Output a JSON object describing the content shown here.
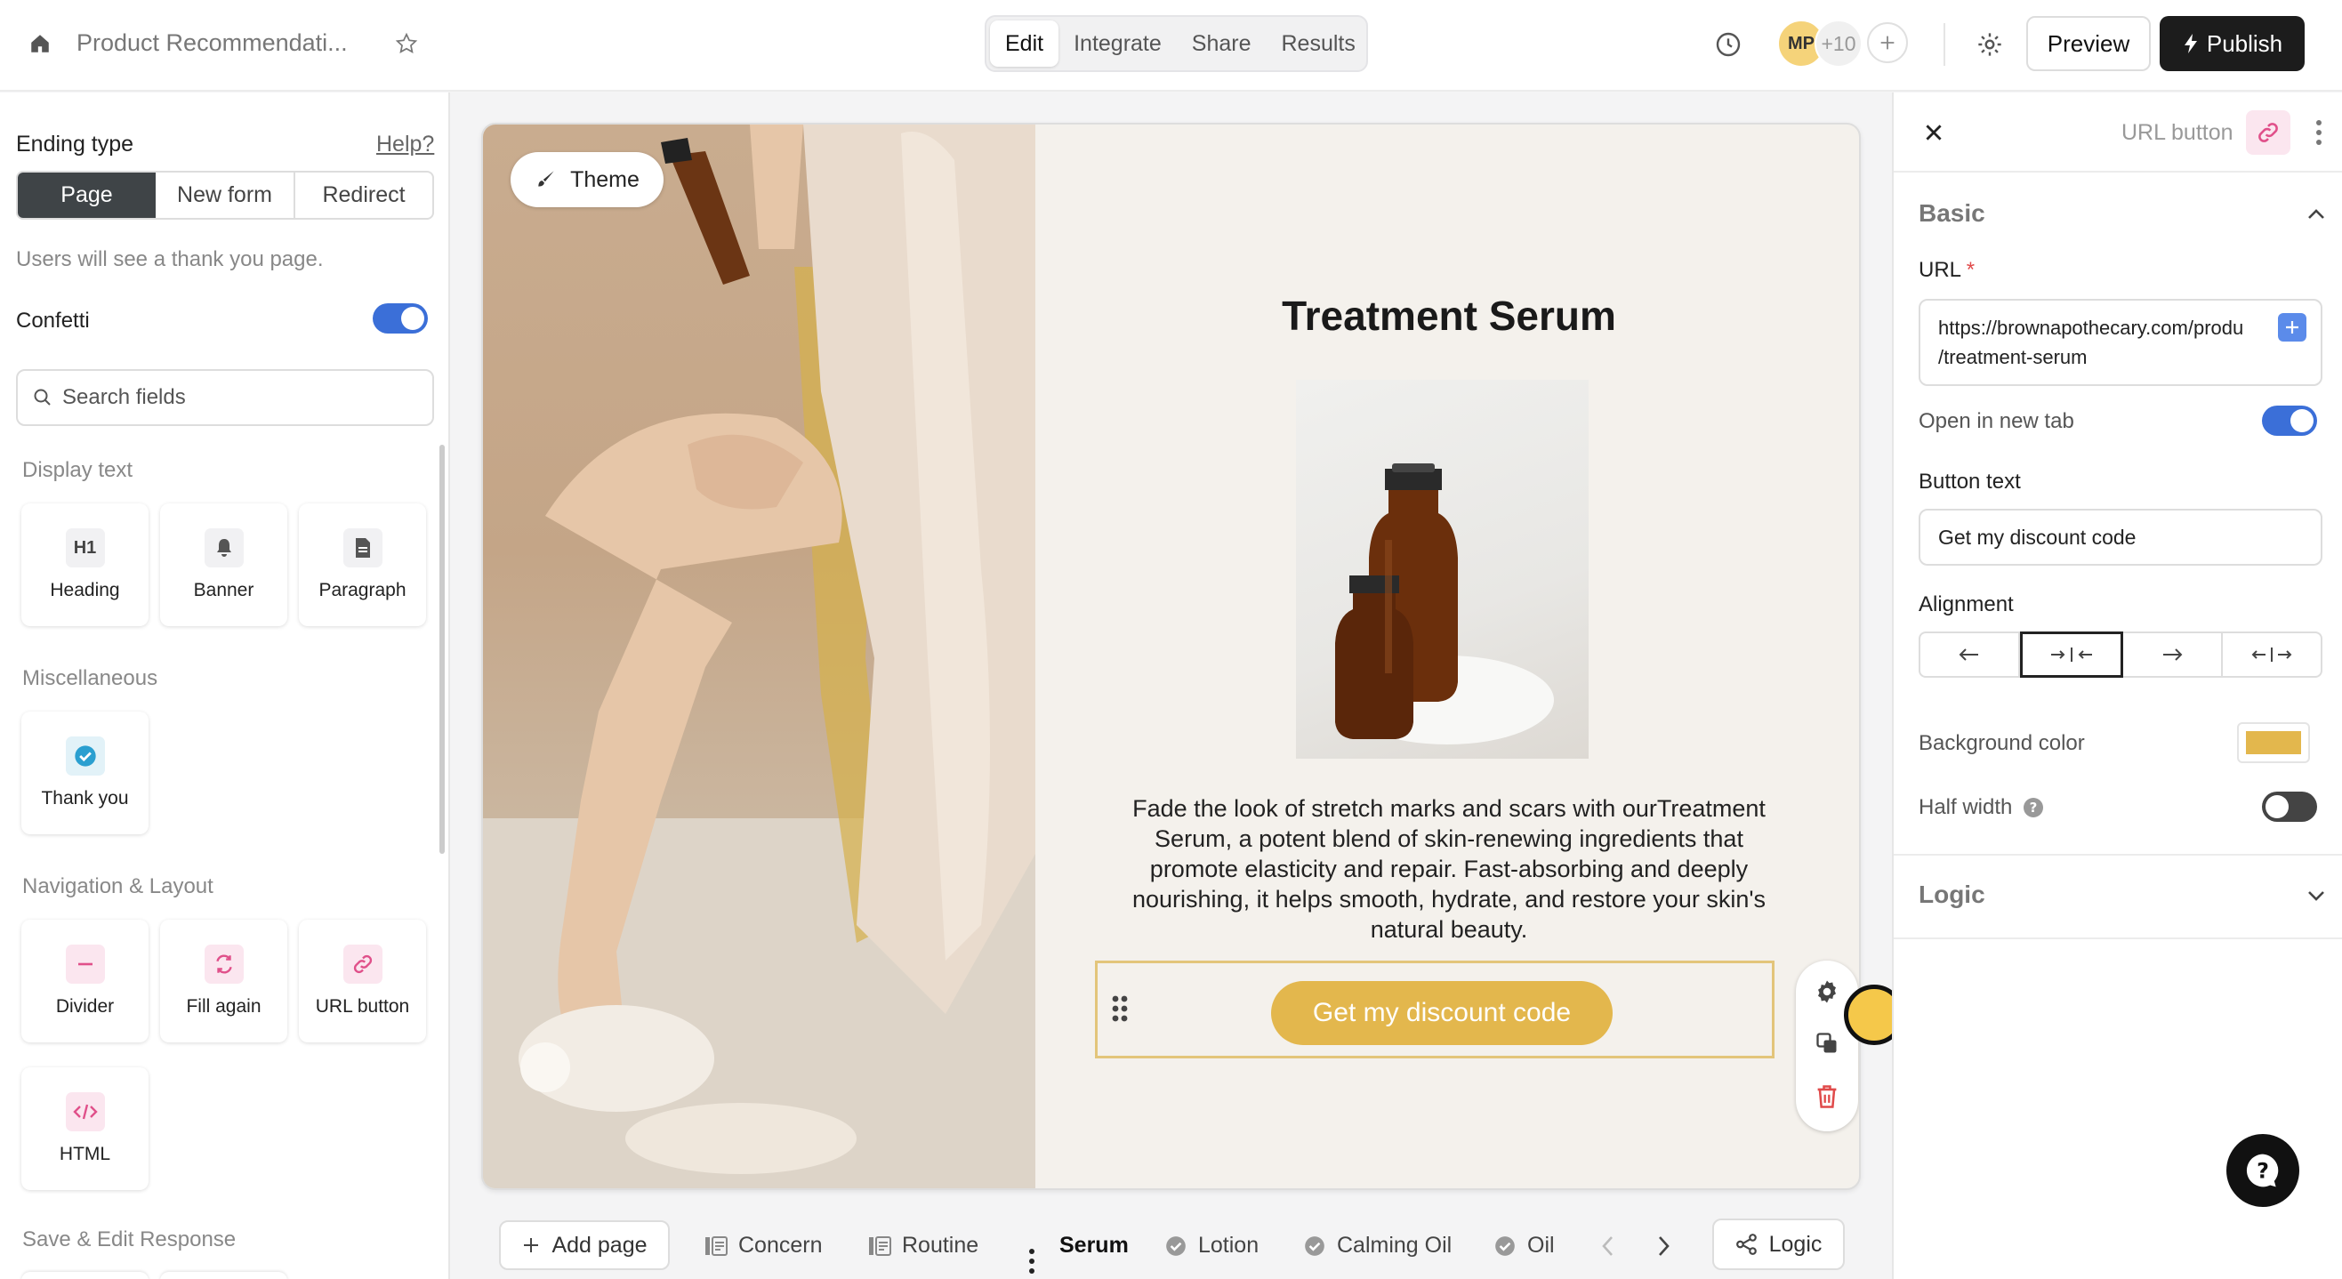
{
  "header": {
    "title": "Product Recommendati...",
    "tabs": [
      "Edit",
      "Integrate",
      "Share",
      "Results"
    ],
    "avatar_initials": "MP",
    "collaborators": "+10",
    "preview_label": "Preview",
    "publish_label": "Publish"
  },
  "left_panel": {
    "ending_type_label": "Ending type",
    "help_label": "Help?",
    "ending_options": [
      "Page",
      "New form",
      "Redirect"
    ],
    "ending_hint": "Users will see a thank you page.",
    "confetti_label": "Confetti",
    "search_placeholder": "Search fields",
    "sections": {
      "display_text": "Display text",
      "misc": "Miscellaneous",
      "nav": "Navigation & Layout",
      "save": "Save & Edit Response"
    },
    "display_items": [
      "Heading",
      "Banner",
      "Paragraph"
    ],
    "misc_items": [
      "Thank you"
    ],
    "nav_items": [
      "Divider",
      "Fill again",
      "URL button",
      "HTML"
    ]
  },
  "canvas": {
    "theme_label": "Theme",
    "heading": "Treatment Serum",
    "paragraph": "Fade the look of stretch marks and scars with ourTreatment Serum, a potent blend of skin-renewing ingredients that promote elasticity and repair. Fast-absorbing and deeply nourishing, it helps smooth, hydrate, and restore your skin's natural beauty.",
    "button_label": "Get my discount code",
    "button_color": "#e3b74d"
  },
  "page_tabs": {
    "add_page": "Add page",
    "pages": [
      "Concern",
      "Routine",
      "Serum",
      "Lotion",
      "Calming Oil",
      "Oil"
    ],
    "active": "Serum",
    "logic_label": "Logic"
  },
  "right_panel": {
    "title": "URL button",
    "basic_label": "Basic",
    "url_label": "URL",
    "url_line1": "https://brownapothecary.com/produ",
    "url_line2": "/treatment-serum",
    "open_new_tab_label": "Open in new tab",
    "button_text_label": "Button text",
    "button_text_value": "Get my discount code",
    "alignment_label": "Alignment",
    "bg_color_label": "Background color",
    "bg_color": "#e3b74d",
    "half_width_label": "Half width",
    "logic_label": "Logic"
  },
  "colors": {
    "toggle_on": "#3b6fd8",
    "dark": "#1c1c1c",
    "pink": "#e0508a",
    "accent_yellow": "#e3b74d"
  }
}
